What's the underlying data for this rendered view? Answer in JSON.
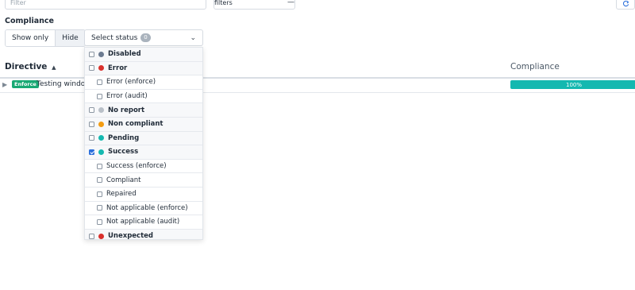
{
  "filter": {
    "placeholder": "Filter"
  },
  "hide_filters_button": {
    "label": "Hide compliance filters",
    "icon": "minus"
  },
  "refresh_button": {
    "icon": "refresh"
  },
  "compliance_section": {
    "title": "Compliance",
    "toggle": {
      "show_only": "Show only",
      "hide": "Hide",
      "selected": "Hide"
    },
    "status_select": {
      "label": "Select status",
      "count": "0"
    }
  },
  "table": {
    "headers": {
      "directive": "Directive",
      "compliance": "Compliance"
    },
    "sort": "ascending",
    "rows": [
      {
        "badge": "Enforce",
        "name": "Testing windows",
        "compliance": "100%",
        "compliance_fraction": 1.0
      }
    ]
  },
  "status_options": [
    {
      "label": "Disabled",
      "type": "group",
      "checked": false,
      "dot_color": "#6b7a90",
      "icon": "disabled-dot"
    },
    {
      "label": "Error",
      "type": "group",
      "checked": false,
      "dot_color": "#d9302c",
      "icon": "error-dot"
    },
    {
      "label": "Error (enforce)",
      "type": "child",
      "checked": false
    },
    {
      "label": "Error (audit)",
      "type": "child",
      "checked": false
    },
    {
      "label": "No report",
      "type": "group",
      "checked": false,
      "dot_color": "#b9c0c8",
      "icon": "no-report-dot"
    },
    {
      "label": "Non compliant",
      "type": "group",
      "checked": false,
      "dot_color": "#f39c12",
      "icon": "non-compliant-dot"
    },
    {
      "label": "Pending",
      "type": "group",
      "checked": false,
      "dot_color": "#14b8b0",
      "icon": "pending-dot"
    },
    {
      "label": "Success",
      "type": "group",
      "checked": true,
      "dot_color": "#14b8b0",
      "icon": "success-dot"
    },
    {
      "label": "Success (enforce)",
      "type": "child",
      "checked": false
    },
    {
      "label": "Compliant",
      "type": "child",
      "checked": false
    },
    {
      "label": "Repaired",
      "type": "child",
      "checked": false
    },
    {
      "label": "Not applicable (enforce)",
      "type": "child",
      "checked": false
    },
    {
      "label": "Not applicable (audit)",
      "type": "child",
      "checked": false
    },
    {
      "label": "Unexpected",
      "type": "group",
      "checked": false,
      "dot_color": "#d9302c",
      "icon": "unexpected-dot"
    }
  ]
}
